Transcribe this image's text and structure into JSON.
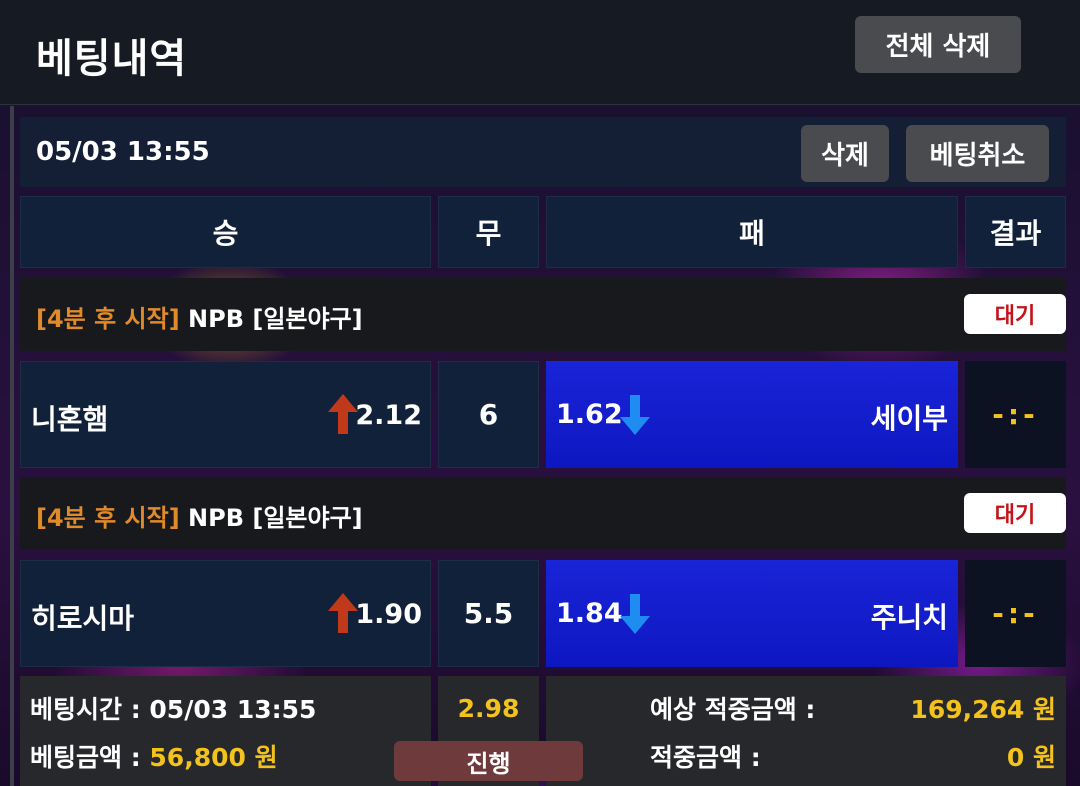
{
  "header": {
    "title": "베팅내역",
    "delete_all_label": "전체 삭제"
  },
  "bet": {
    "datetime": "05/03 13:55",
    "delete_label": "삭제",
    "cancel_label": "베팅취소",
    "columns": {
      "win": "승",
      "draw": "무",
      "loss": "패",
      "result": "결과"
    },
    "games": [
      {
        "start_info": "[4분 후 시작]",
        "league": "NPB [일본야구]",
        "status": "대기",
        "home_team": "니혼햄",
        "home_odds": "2.12",
        "home_trend": "up",
        "draw_value": "6",
        "away_odds": "1.62",
        "away_trend": "down",
        "away_team": "세이부",
        "result": "-:-",
        "selected": "away"
      },
      {
        "start_info": "[4분 후 시작]",
        "league": "NPB [일본야구]",
        "status": "대기",
        "home_team": "히로시마",
        "home_odds": "1.90",
        "home_trend": "up",
        "draw_value": "5.5",
        "away_odds": "1.84",
        "away_trend": "down",
        "away_team": "주니치",
        "result": "-:-",
        "selected": "away"
      }
    ],
    "footer": {
      "bet_time_label": "베팅시간 : ",
      "bet_time_value": "05/03 13:55",
      "bet_amount_label": "베팅금액 : ",
      "bet_amount_value": "56,800 원",
      "total_odds": "2.98",
      "progress_label": "진행",
      "expected_win_label": "예상 적중금액 :",
      "expected_win_value": "169,264 원",
      "win_amount_label": "적중금액 :",
      "win_amount_value": "0 원"
    }
  },
  "colors": {
    "selected_bg": "#1a24d8",
    "odds_up": "#c0391b",
    "odds_down": "#1e8cf0",
    "accent_yellow": "#f3c21c",
    "start_orange": "#e08a2a",
    "status_red": "#c4141a"
  }
}
